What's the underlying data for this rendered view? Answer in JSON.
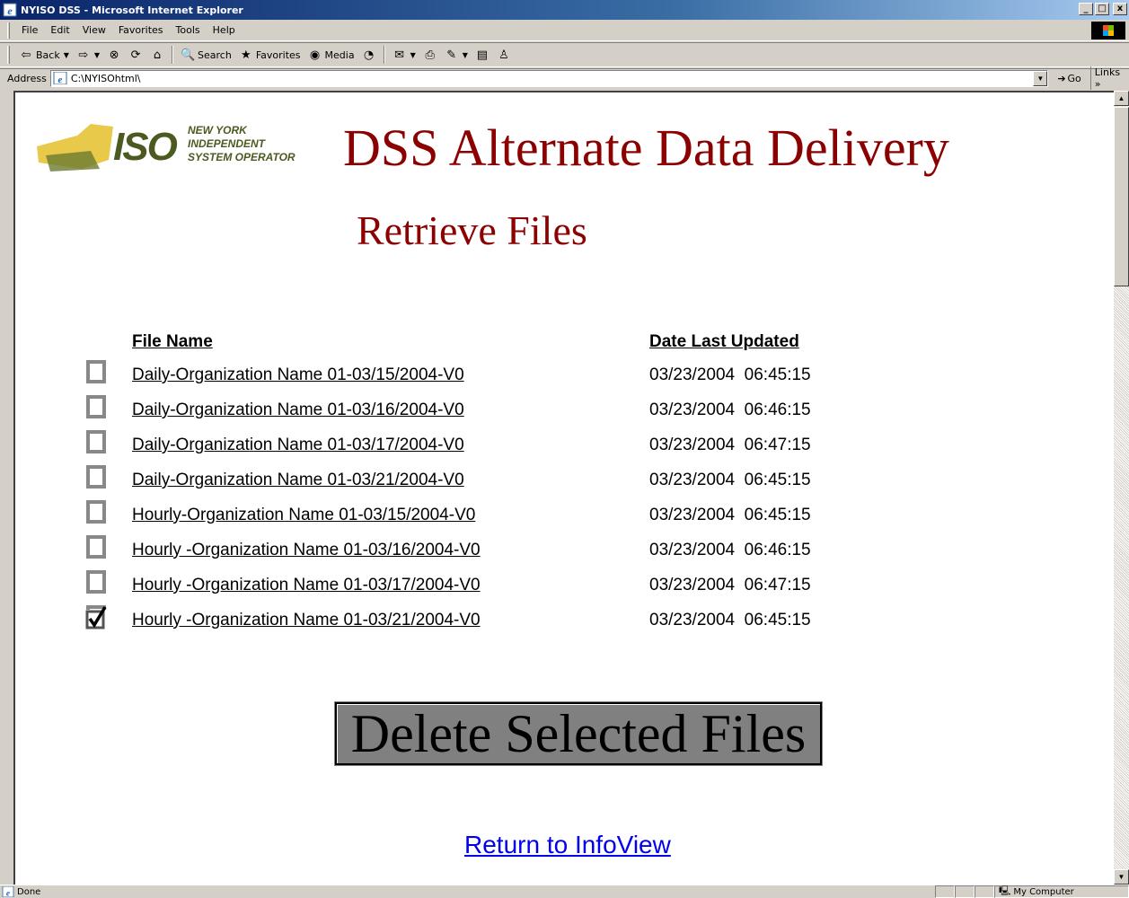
{
  "window": {
    "title": "NYISO DSS - Microsoft Internet Explorer",
    "minimize": "_",
    "maximize": "□",
    "close": "x"
  },
  "menu": [
    "File",
    "Edit",
    "View",
    "Favorites",
    "Tools",
    "Help"
  ],
  "toolbar": {
    "back": "Back",
    "search": "Search",
    "favorites": "Favorites",
    "media": "Media"
  },
  "address": {
    "label": "Address",
    "value": "C:\\NYISOhtml\\",
    "go": "Go",
    "links": "Links"
  },
  "page": {
    "logo_text": [
      "NEW YORK",
      "INDEPENDENT",
      "SYSTEM OPERATOR"
    ],
    "heading": "DSS Alternate Data Delivery",
    "subheading": "Retrieve Files",
    "col_file_name": "File Name",
    "col_date": "Date Last Updated",
    "files": [
      {
        "name": "Daily-Organization Name 01-03/15/2004-V0",
        "date": "03/23/2004  06:45:15",
        "checked": false
      },
      {
        "name": "Daily-Organization Name 01-03/16/2004-V0",
        "date": "03/23/2004  06:46:15",
        "checked": false
      },
      {
        "name": "Daily-Organization Name 01-03/17/2004-V0",
        "date": "03/23/2004  06:47:15",
        "checked": false
      },
      {
        "name": "Daily-Organization Name 01-03/21/2004-V0",
        "date": "03/23/2004  06:45:15",
        "checked": false
      },
      {
        "name": "Hourly-Organization Name 01-03/15/2004-V0",
        "date": "03/23/2004  06:45:15",
        "checked": false
      },
      {
        "name": "Hourly -Organization Name 01-03/16/2004-V0",
        "date": "03/23/2004  06:46:15",
        "checked": false
      },
      {
        "name": "Hourly -Organization Name 01-03/17/2004-V0",
        "date": "03/23/2004  06:47:15",
        "checked": false
      },
      {
        "name": "Hourly -Organization Name 01-03/21/2004-V0",
        "date": "03/23/2004  06:45:15",
        "checked": true
      }
    ],
    "delete_button": "Delete Selected Files",
    "return_link": "Return to InfoView"
  },
  "status": {
    "left": "Done",
    "zone": "My Computer"
  },
  "colors": {
    "heading": "#8b0000",
    "link": "#0000ee",
    "titlebar": "#0a246a"
  }
}
